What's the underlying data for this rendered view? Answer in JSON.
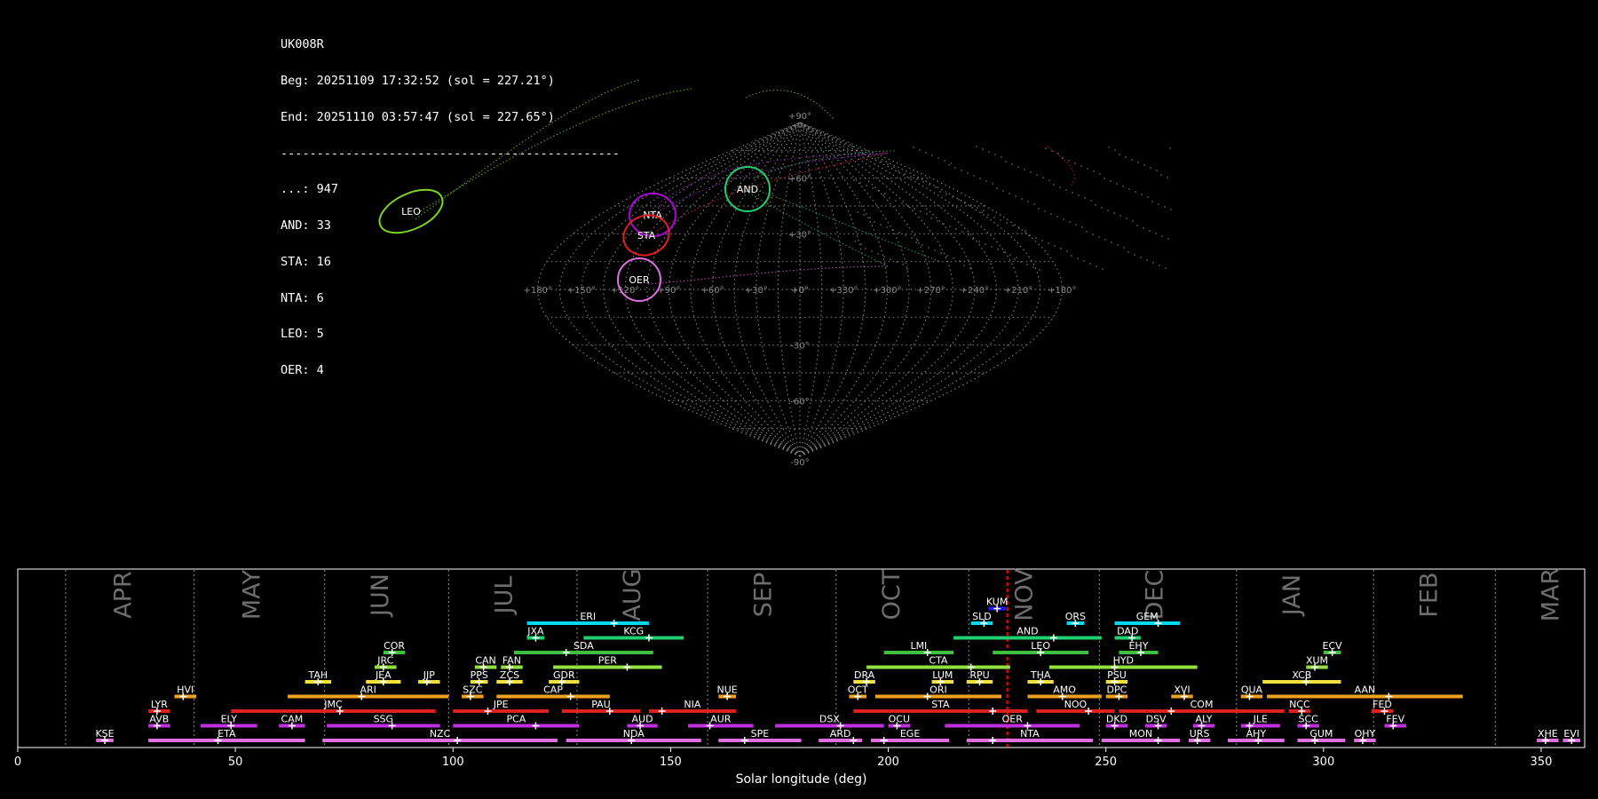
{
  "info": {
    "camera": "UK008R",
    "begin": "Beg: 20251109 17:32:52 (sol = 227.21°)",
    "end": "End: 20251110 03:57:47 (sol = 227.65°)",
    "separator": "-----------------------------------------------",
    "counts": [
      "...: 947",
      "AND: 33",
      "STA: 16",
      "NTA: 6",
      "LEO: 5",
      "OER: 4"
    ]
  },
  "colors": {
    "background": "#000000",
    "grid": "#8c8c8c",
    "current_sol_line": "#d40000"
  },
  "chart_data": [
    {
      "type": "scatter",
      "description_projection": "sinusoidal",
      "x_tick_labels": [
        "+180°",
        "+150°",
        "+120°",
        "+90°",
        "+60°",
        "+30°",
        "+0°",
        "+330°",
        "+300°",
        "+270°",
        "+240°",
        "+210°",
        "+180°"
      ],
      "y_tick_labels": [
        "+90°",
        "+60°",
        "+30°",
        "+0°",
        "-30°",
        "-60°",
        "-90°"
      ],
      "radiants": [
        {
          "name": "LEO",
          "color": "#7fd321"
        },
        {
          "name": "NTA",
          "color": "#b000d8"
        },
        {
          "name": "STA",
          "color": "#e02020"
        },
        {
          "name": "AND",
          "color": "#20d070"
        },
        {
          "name": "OER",
          "color": "#e070e0"
        }
      ]
    },
    {
      "type": "table",
      "xlabel": "Solar longitude (deg)",
      "xlim": [
        0,
        360
      ],
      "x_ticks": [
        0,
        50,
        100,
        150,
        200,
        250,
        300,
        350
      ],
      "current_sol": 227.4,
      "months": [
        {
          "name": "APR",
          "start": 11,
          "label_sol": 24.5
        },
        {
          "name": "MAY",
          "start": 40.5,
          "label_sol": 54
        },
        {
          "name": "JUN",
          "start": 70.5,
          "label_sol": 83.5
        },
        {
          "name": "JUL",
          "start": 99,
          "label_sol": 112
        },
        {
          "name": "AUG",
          "start": 128.5,
          "label_sol": 141.5
        },
        {
          "name": "SEP",
          "start": 158.5,
          "label_sol": 171.5
        },
        {
          "name": "OCT",
          "start": 188,
          "label_sol": 201
        },
        {
          "name": "NOV",
          "start": 218.5,
          "label_sol": 231.5
        },
        {
          "name": "DEC",
          "start": 248.5,
          "label_sol": 261.5
        },
        {
          "name": "JAN",
          "start": 280,
          "label_sol": 293
        },
        {
          "name": "FEB",
          "start": 311.5,
          "label_sol": 324.5
        },
        {
          "name": "MAR",
          "start": 339.5,
          "label_sol": 352.5
        }
      ],
      "showers": [
        {
          "code": "KUM",
          "start": 223,
          "end": 227,
          "peak": 225,
          "row": 10,
          "color": "#1a1aff"
        },
        {
          "code": "ERI",
          "start": 117,
          "end": 145,
          "peak": 137,
          "row": 9,
          "color": "#00d8f0"
        },
        {
          "code": "SLD",
          "start": 219,
          "end": 224,
          "peak": 222,
          "row": 9,
          "color": "#00d8f0"
        },
        {
          "code": "ORS",
          "start": 241,
          "end": 245,
          "peak": 243,
          "row": 9,
          "color": "#00d8f0"
        },
        {
          "code": "GEM",
          "start": 252,
          "end": 267,
          "peak": 262,
          "row": 9,
          "color": "#00d8f0"
        },
        {
          "code": "JXA",
          "start": 117,
          "end": 121,
          "peak": 119,
          "row": 8,
          "color": "#20d070"
        },
        {
          "code": "KCG",
          "start": 130,
          "end": 153,
          "peak": 145,
          "row": 8,
          "color": "#20d070"
        },
        {
          "code": "AND",
          "start": 215,
          "end": 249,
          "peak": 238,
          "row": 8,
          "color": "#20d070"
        },
        {
          "code": "DAD",
          "start": 252,
          "end": 258,
          "peak": 256,
          "row": 8,
          "color": "#20d070"
        },
        {
          "code": "COR",
          "start": 84,
          "end": 89,
          "peak": 86,
          "row": 7,
          "color": "#40c040"
        },
        {
          "code": "SDA",
          "start": 114,
          "end": 146,
          "peak": 126,
          "row": 7,
          "color": "#40c040"
        },
        {
          "code": "LMI",
          "start": 199,
          "end": 215,
          "peak": 209,
          "row": 7,
          "color": "#40c040"
        },
        {
          "code": "LEO",
          "start": 224,
          "end": 246,
          "peak": 235,
          "row": 7,
          "color": "#40c040"
        },
        {
          "code": "EHY",
          "start": 253,
          "end": 262,
          "peak": 258,
          "row": 7,
          "color": "#40c040"
        },
        {
          "code": "ECV",
          "start": 300,
          "end": 304,
          "peak": 302,
          "row": 7,
          "color": "#40c040"
        },
        {
          "code": "JRC",
          "start": 82,
          "end": 87,
          "peak": 84,
          "row": 6,
          "color": "#90e040"
        },
        {
          "code": "CAN",
          "start": 105,
          "end": 110,
          "peak": 107,
          "row": 6,
          "color": "#90e040"
        },
        {
          "code": "FAN",
          "start": 111,
          "end": 116,
          "peak": 113,
          "row": 6,
          "color": "#90e040"
        },
        {
          "code": "PER",
          "start": 123,
          "end": 148,
          "peak": 140,
          "row": 6,
          "color": "#90e040"
        },
        {
          "code": "CTA",
          "start": 195,
          "end": 228,
          "peak": 219,
          "row": 6,
          "color": "#90e040"
        },
        {
          "code": "HYD",
          "start": 237,
          "end": 271,
          "peak": 252,
          "row": 6,
          "color": "#90e040"
        },
        {
          "code": "XUM",
          "start": 296,
          "end": 301,
          "peak": 298,
          "row": 6,
          "color": "#90e040"
        },
        {
          "code": "TAH",
          "start": 66,
          "end": 72,
          "peak": 69,
          "row": 5,
          "color": "#f0e040"
        },
        {
          "code": "JEA",
          "start": 80,
          "end": 88,
          "peak": 84,
          "row": 5,
          "color": "#f0e040"
        },
        {
          "code": "JIP",
          "start": 92,
          "end": 97,
          "peak": 94,
          "row": 5,
          "color": "#f0e040"
        },
        {
          "code": "PPS",
          "start": 104,
          "end": 108,
          "peak": 106,
          "row": 5,
          "color": "#f0e040"
        },
        {
          "code": "ZCS",
          "start": 110,
          "end": 116,
          "peak": 113,
          "row": 5,
          "color": "#f0e040"
        },
        {
          "code": "GDR",
          "start": 122,
          "end": 129,
          "peak": 125,
          "row": 5,
          "color": "#f0e040"
        },
        {
          "code": "DRA",
          "start": 192,
          "end": 197,
          "peak": 195,
          "row": 5,
          "color": "#f0e040"
        },
        {
          "code": "LUM",
          "start": 210,
          "end": 215,
          "peak": 212,
          "row": 5,
          "color": "#f0e040"
        },
        {
          "code": "RPU",
          "start": 218,
          "end": 224,
          "peak": 221,
          "row": 5,
          "color": "#f0e040"
        },
        {
          "code": "THA",
          "start": 232,
          "end": 238,
          "peak": 235,
          "row": 5,
          "color": "#f0e040"
        },
        {
          "code": "PSU",
          "start": 250,
          "end": 255,
          "peak": 252,
          "row": 5,
          "color": "#f0e040"
        },
        {
          "code": "XCB",
          "start": 286,
          "end": 304,
          "peak": 296,
          "row": 5,
          "color": "#f0e040"
        },
        {
          "code": "HVI",
          "start": 36,
          "end": 41,
          "peak": 38,
          "row": 4,
          "color": "#f0a020"
        },
        {
          "code": "ARI",
          "start": 62,
          "end": 99,
          "peak": 79,
          "row": 4,
          "color": "#f0a020"
        },
        {
          "code": "SZC",
          "start": 102,
          "end": 107,
          "peak": 104,
          "row": 4,
          "color": "#f0a020"
        },
        {
          "code": "CAP",
          "start": 110,
          "end": 136,
          "peak": 127,
          "row": 4,
          "color": "#f0a020"
        },
        {
          "code": "NUE",
          "start": 161,
          "end": 165,
          "peak": 163,
          "row": 4,
          "color": "#f0a020"
        },
        {
          "code": "OCT",
          "start": 191,
          "end": 195,
          "peak": 193,
          "row": 4,
          "color": "#f0a020"
        },
        {
          "code": "ORI",
          "start": 197,
          "end": 226,
          "peak": 209,
          "row": 4,
          "color": "#f0a020"
        },
        {
          "code": "AMO",
          "start": 232,
          "end": 249,
          "peak": 240,
          "row": 4,
          "color": "#f0a020"
        },
        {
          "code": "DPC",
          "start": 250,
          "end": 255,
          "peak": 253,
          "row": 4,
          "color": "#f0a020"
        },
        {
          "code": "XVI",
          "start": 265,
          "end": 270,
          "peak": 268,
          "row": 4,
          "color": "#f0a020"
        },
        {
          "code": "QUA",
          "start": 281,
          "end": 286,
          "peak": 283,
          "row": 4,
          "color": "#f0a020"
        },
        {
          "code": "AAN",
          "start": 287,
          "end": 332,
          "peak": 315,
          "row": 4,
          "color": "#f0a020"
        },
        {
          "code": "LYR",
          "start": 30,
          "end": 35,
          "peak": 32,
          "row": 3,
          "color": "#e02020"
        },
        {
          "code": "JMC",
          "start": 49,
          "end": 96,
          "peak": 74,
          "row": 3,
          "color": "#e02020"
        },
        {
          "code": "JPE",
          "start": 100,
          "end": 122,
          "peak": 108,
          "row": 3,
          "color": "#e02020"
        },
        {
          "code": "PAU",
          "start": 125,
          "end": 143,
          "peak": 136,
          "row": 3,
          "color": "#e02020"
        },
        {
          "code": "NIA",
          "start": 145,
          "end": 165,
          "peak": 148,
          "row": 3,
          "color": "#e02020"
        },
        {
          "code": "STA",
          "start": 192,
          "end": 232,
          "peak": 224,
          "row": 3,
          "color": "#e02020"
        },
        {
          "code": "NOO",
          "start": 234,
          "end": 252,
          "peak": 246,
          "row": 3,
          "color": "#e02020"
        },
        {
          "code": "COM",
          "start": 253,
          "end": 291,
          "peak": 265,
          "row": 3,
          "color": "#e02020"
        },
        {
          "code": "NCC",
          "start": 292,
          "end": 297,
          "peak": 295,
          "row": 3,
          "color": "#e02020"
        },
        {
          "code": "FED",
          "start": 311,
          "end": 316,
          "peak": 314,
          "row": 3,
          "color": "#e02020"
        },
        {
          "code": "AVB",
          "start": 30,
          "end": 35,
          "peak": 32,
          "row": 2,
          "color": "#c030e0"
        },
        {
          "code": "ELY",
          "start": 42,
          "end": 55,
          "peak": 49,
          "row": 2,
          "color": "#c030e0"
        },
        {
          "code": "CAM",
          "start": 60,
          "end": 66,
          "peak": 63,
          "row": 2,
          "color": "#c030e0"
        },
        {
          "code": "SSG",
          "start": 71,
          "end": 97,
          "peak": 86,
          "row": 2,
          "color": "#c030e0"
        },
        {
          "code": "PCA",
          "start": 100,
          "end": 129,
          "peak": 119,
          "row": 2,
          "color": "#c030e0"
        },
        {
          "code": "AUD",
          "start": 140,
          "end": 147,
          "peak": 143,
          "row": 2,
          "color": "#c030e0"
        },
        {
          "code": "AUR",
          "start": 154,
          "end": 169,
          "peak": 159,
          "row": 2,
          "color": "#c030e0"
        },
        {
          "code": "DSX",
          "start": 174,
          "end": 199,
          "peak": 189,
          "row": 2,
          "color": "#c030e0"
        },
        {
          "code": "OCU",
          "start": 200,
          "end": 205,
          "peak": 202,
          "row": 2,
          "color": "#c030e0"
        },
        {
          "code": "OER",
          "start": 213,
          "end": 244,
          "peak": 232,
          "row": 2,
          "color": "#c030e0"
        },
        {
          "code": "DKD",
          "start": 250,
          "end": 255,
          "peak": 252,
          "row": 2,
          "color": "#c030e0"
        },
        {
          "code": "DSV",
          "start": 259,
          "end": 264,
          "peak": 262,
          "row": 2,
          "color": "#c030e0"
        },
        {
          "code": "ALY",
          "start": 270,
          "end": 275,
          "peak": 272,
          "row": 2,
          "color": "#c030e0"
        },
        {
          "code": "JLE",
          "start": 281,
          "end": 290,
          "peak": 283,
          "row": 2,
          "color": "#c030e0"
        },
        {
          "code": "SCC",
          "start": 294,
          "end": 299,
          "peak": 296,
          "row": 2,
          "color": "#c030e0"
        },
        {
          "code": "FEV",
          "start": 314,
          "end": 319,
          "peak": 316,
          "row": 2,
          "color": "#c030e0"
        },
        {
          "code": "KSE",
          "start": 18,
          "end": 22,
          "peak": 20,
          "row": 1,
          "color": "#e070e0"
        },
        {
          "code": "ETA",
          "start": 30,
          "end": 66,
          "peak": 46,
          "row": 1,
          "color": "#e070e0"
        },
        {
          "code": "NZC",
          "start": 70,
          "end": 124,
          "peak": 101,
          "row": 1,
          "color": "#e070e0"
        },
        {
          "code": "NDA",
          "start": 126,
          "end": 157,
          "peak": 141,
          "row": 1,
          "color": "#e070e0"
        },
        {
          "code": "SPE",
          "start": 161,
          "end": 180,
          "peak": 167,
          "row": 1,
          "color": "#e070e0"
        },
        {
          "code": "ARD",
          "start": 184,
          "end": 194,
          "peak": 192,
          "row": 1,
          "color": "#e070e0"
        },
        {
          "code": "EGE",
          "start": 196,
          "end": 214,
          "peak": 199,
          "row": 1,
          "color": "#e070e0"
        },
        {
          "code": "NTA",
          "start": 218,
          "end": 247,
          "peak": 224,
          "row": 1,
          "color": "#e070e0"
        },
        {
          "code": "MON",
          "start": 249,
          "end": 267,
          "peak": 262,
          "row": 1,
          "color": "#e070e0"
        },
        {
          "code": "URS",
          "start": 269,
          "end": 274,
          "peak": 271,
          "row": 1,
          "color": "#e070e0"
        },
        {
          "code": "AHY",
          "start": 278,
          "end": 291,
          "peak": 285,
          "row": 1,
          "color": "#e070e0"
        },
        {
          "code": "GUM",
          "start": 294,
          "end": 305,
          "peak": 298,
          "row": 1,
          "color": "#e070e0"
        },
        {
          "code": "OHY",
          "start": 307,
          "end": 312,
          "peak": 309,
          "row": 1,
          "color": "#e070e0"
        },
        {
          "code": "XHE",
          "start": 349,
          "end": 354,
          "peak": 351,
          "row": 1,
          "color": "#e070e0"
        },
        {
          "code": "EVI",
          "start": 355,
          "end": 359,
          "peak": 357,
          "row": 1,
          "color": "#e070e0"
        }
      ]
    }
  ]
}
